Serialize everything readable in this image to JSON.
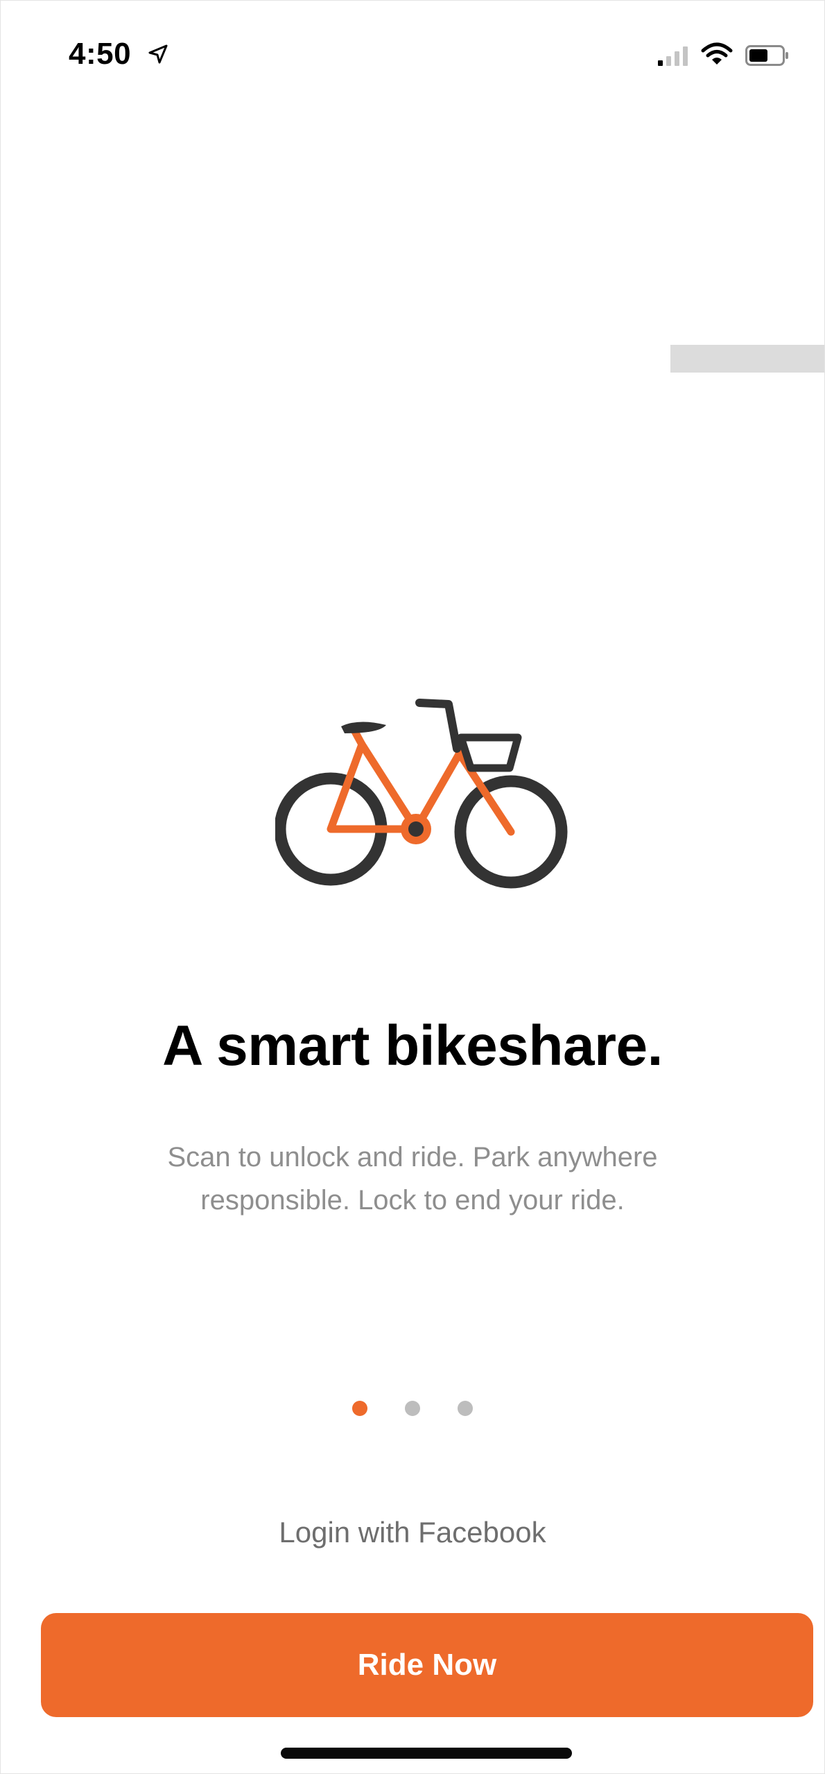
{
  "status_bar": {
    "time": "4:50",
    "location_icon": "location-arrow-icon",
    "signal_icon": "cellular-signal-icon",
    "wifi_icon": "wifi-icon",
    "battery_icon": "battery-icon"
  },
  "illustration": {
    "icon": "bicycle-icon",
    "frame_color": "#ee6a2b",
    "wheel_color": "#333333"
  },
  "onboarding": {
    "headline": "A smart bikeshare.",
    "description": "Scan to unlock and ride. Park anywhere responsible. Lock to end your ride.",
    "page_count": 3,
    "current_page": 1
  },
  "actions": {
    "facebook_login": "Login with Facebook",
    "ride_now": "Ride Now"
  },
  "colors": {
    "accent": "#ee6a2b",
    "dot_inactive": "#bdbdbd",
    "subtext": "#8e8e8e"
  }
}
